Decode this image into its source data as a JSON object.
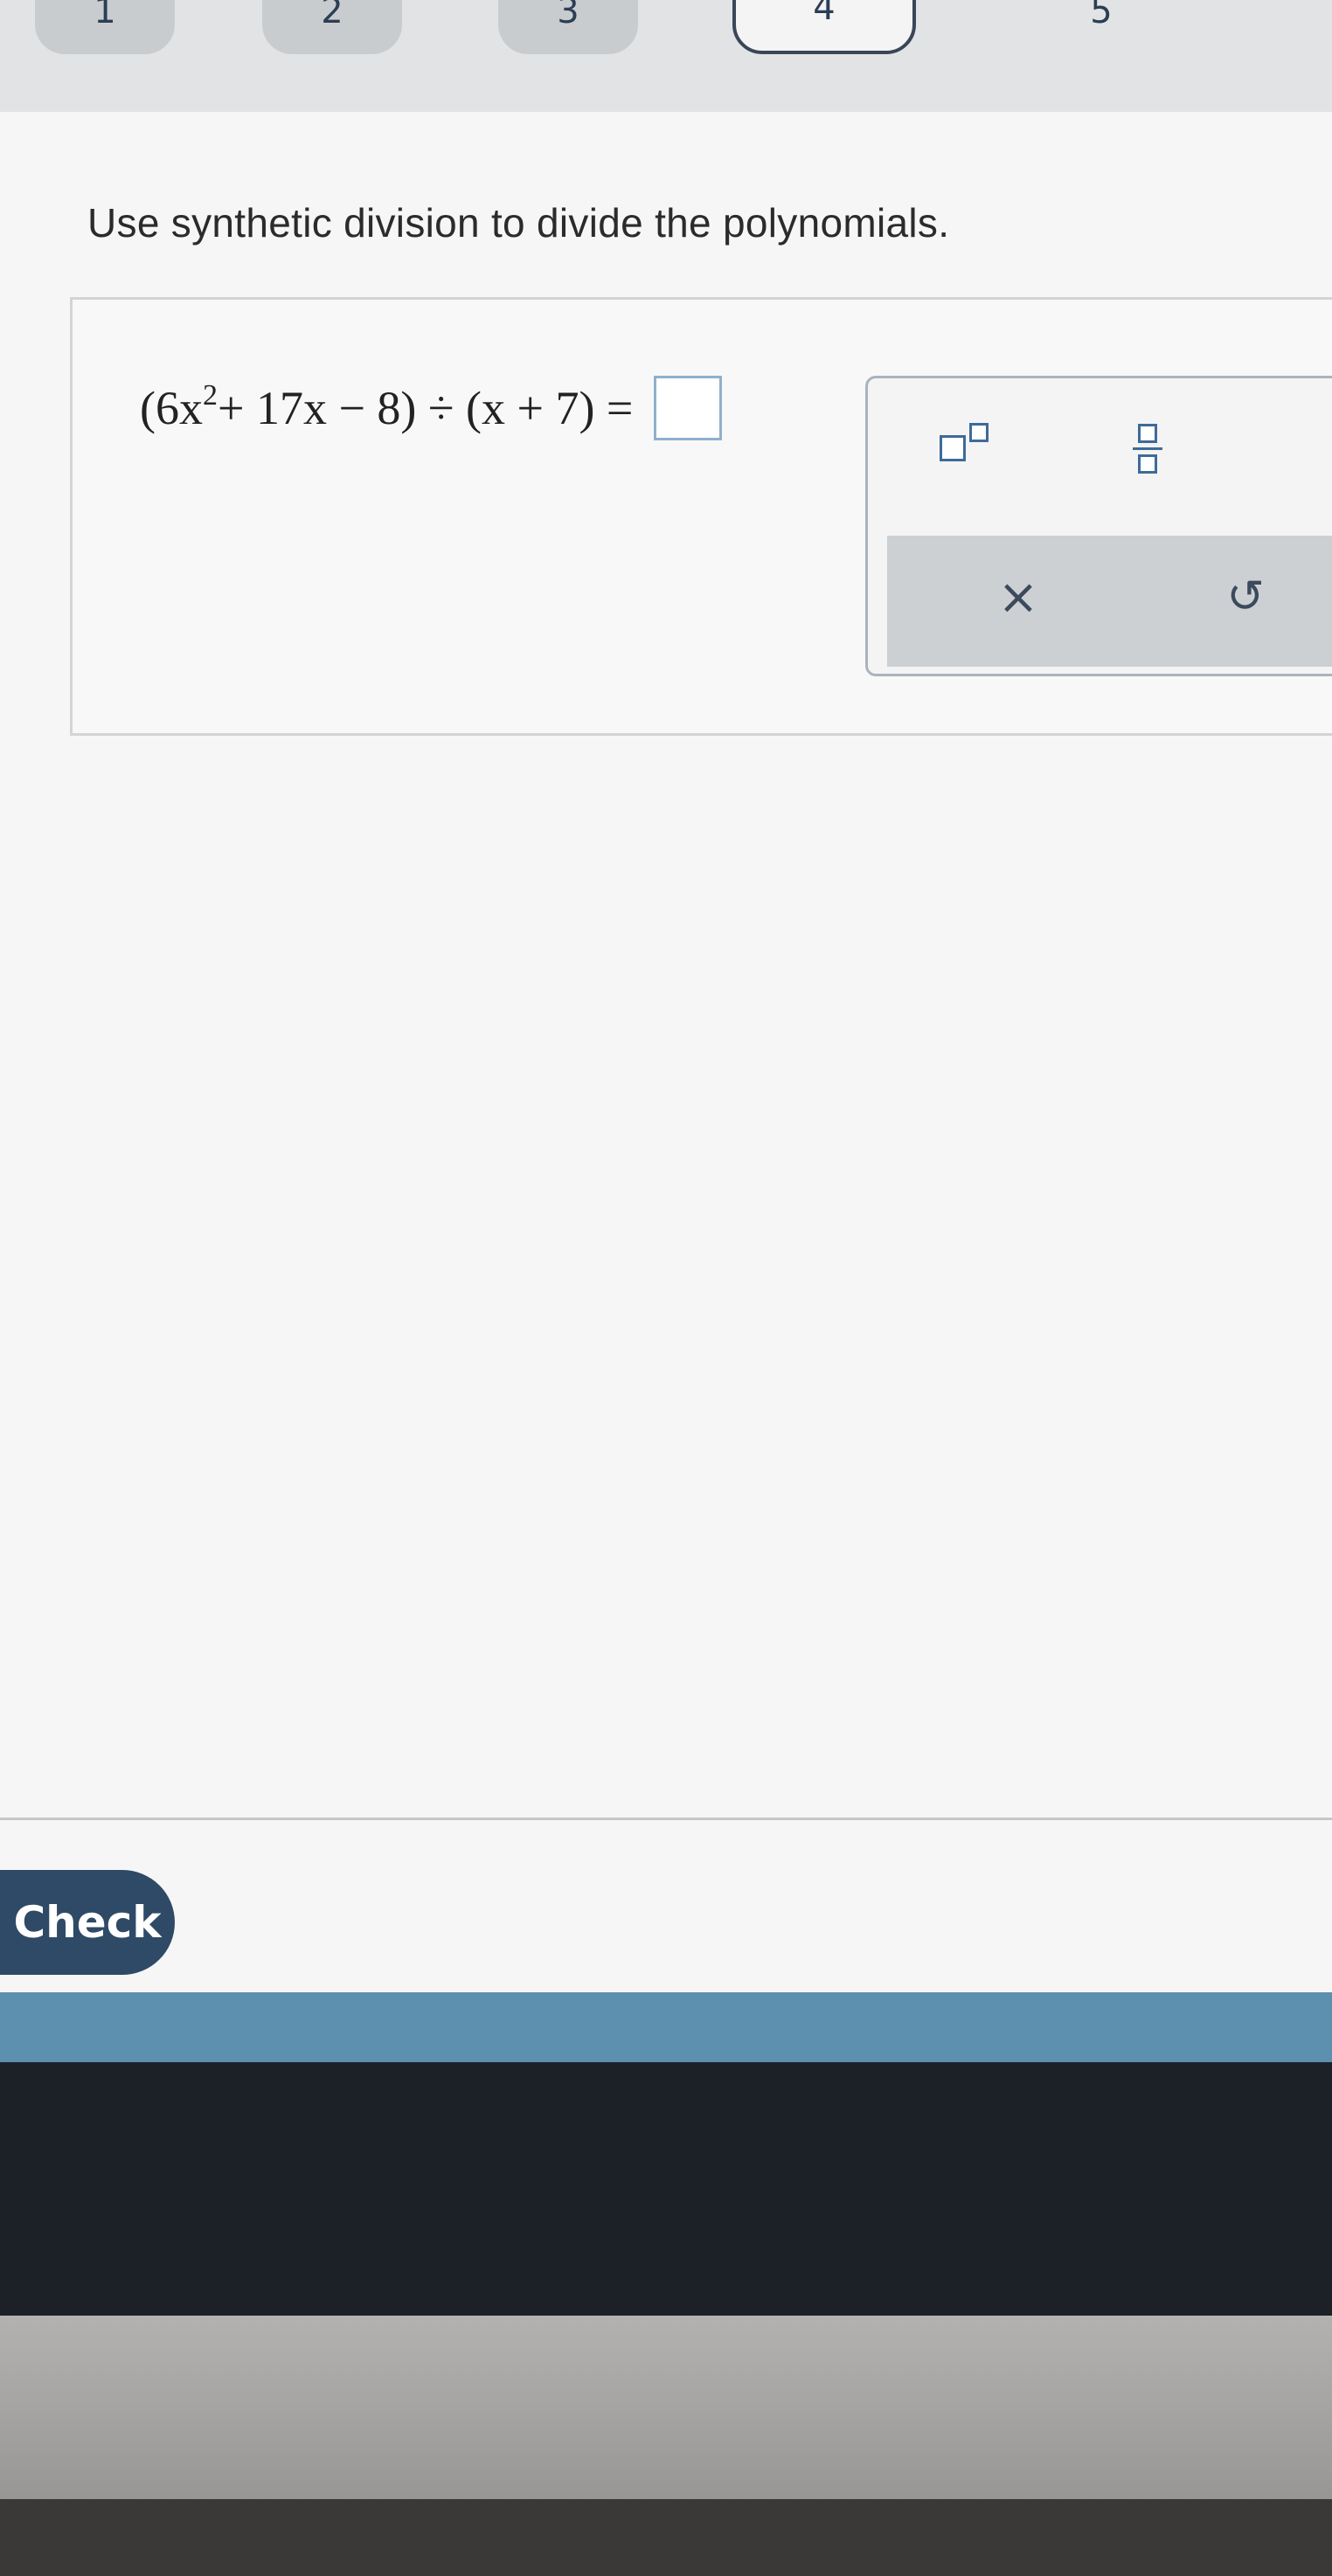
{
  "steps": [
    {
      "label": "1"
    },
    {
      "label": "2"
    },
    {
      "label": "3"
    },
    {
      "label": "4"
    },
    {
      "label": "5"
    }
  ],
  "prompt": "Use synthetic division to divide the polynomials.",
  "equation": {
    "open": "(6x",
    "exponent": "2",
    "rest": " + 17x − 8) ÷ (x + 7) ="
  },
  "palette": {
    "clear_symbol": "×",
    "undo_symbol": "↺"
  },
  "check_label": "Check"
}
